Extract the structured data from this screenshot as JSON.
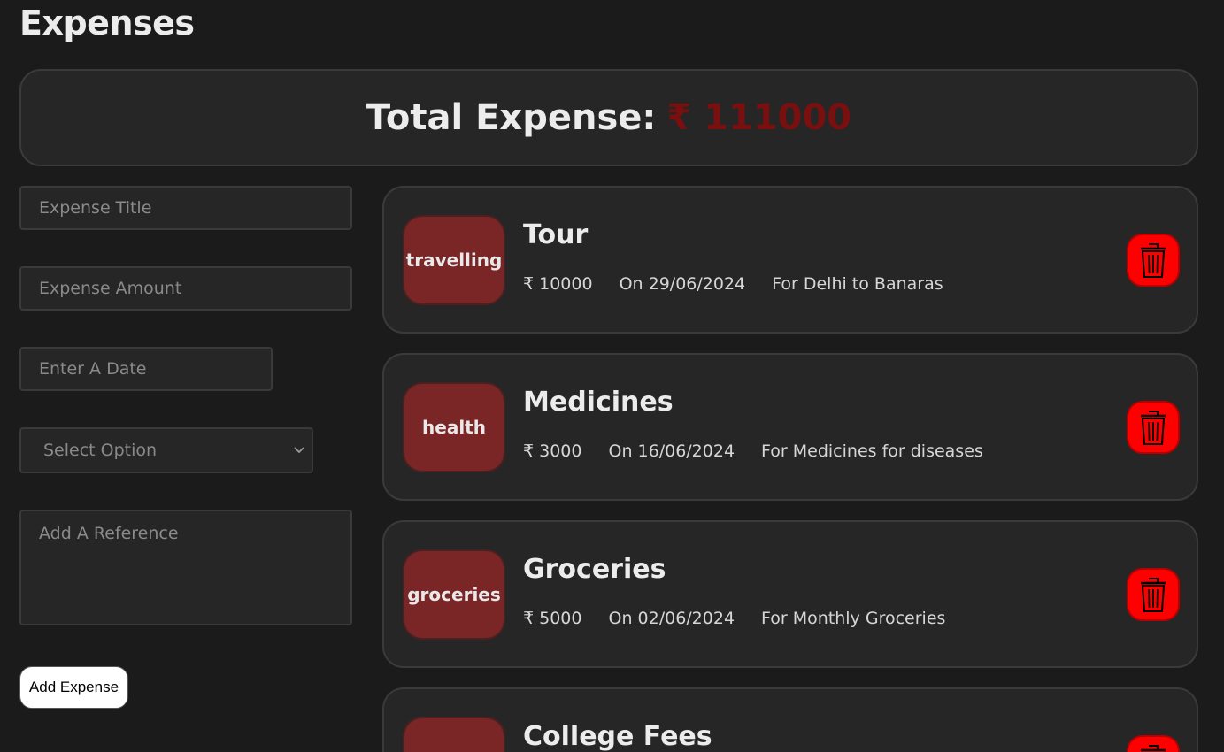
{
  "header": {
    "title": "Expenses"
  },
  "total": {
    "label": "Total Expense:",
    "value": "₹ 111000"
  },
  "form": {
    "title_placeholder": "Expense Title",
    "amount_placeholder": "Expense Amount",
    "date_placeholder": "Enter A Date",
    "select_value": "Select Option",
    "reference_placeholder": "Add A Reference",
    "add_button": "Add Expense"
  },
  "expenses": [
    {
      "category": "travelling",
      "title": "Tour",
      "amount": "₹ 10000",
      "date": "On 29/06/2024",
      "reference": "For Delhi to Banaras"
    },
    {
      "category": "health",
      "title": "Medicines",
      "amount": "₹ 3000",
      "date": "On 16/06/2024",
      "reference": "For Medicines for diseases"
    },
    {
      "category": "groceries",
      "title": "Groceries",
      "amount": "₹ 5000",
      "date": "On 02/06/2024",
      "reference": "For Monthly Groceries"
    },
    {
      "category": "",
      "title": "College Fees",
      "amount": "",
      "date": "",
      "reference": ""
    }
  ],
  "icons": {
    "delete": "trash-icon",
    "select": "chevron-down-icon"
  },
  "colors": {
    "background": "#1b1b1b",
    "card": "#262626",
    "total_value": "#7a0f0f",
    "category_badge": "#7a2626",
    "delete_button": "#ff0000"
  }
}
